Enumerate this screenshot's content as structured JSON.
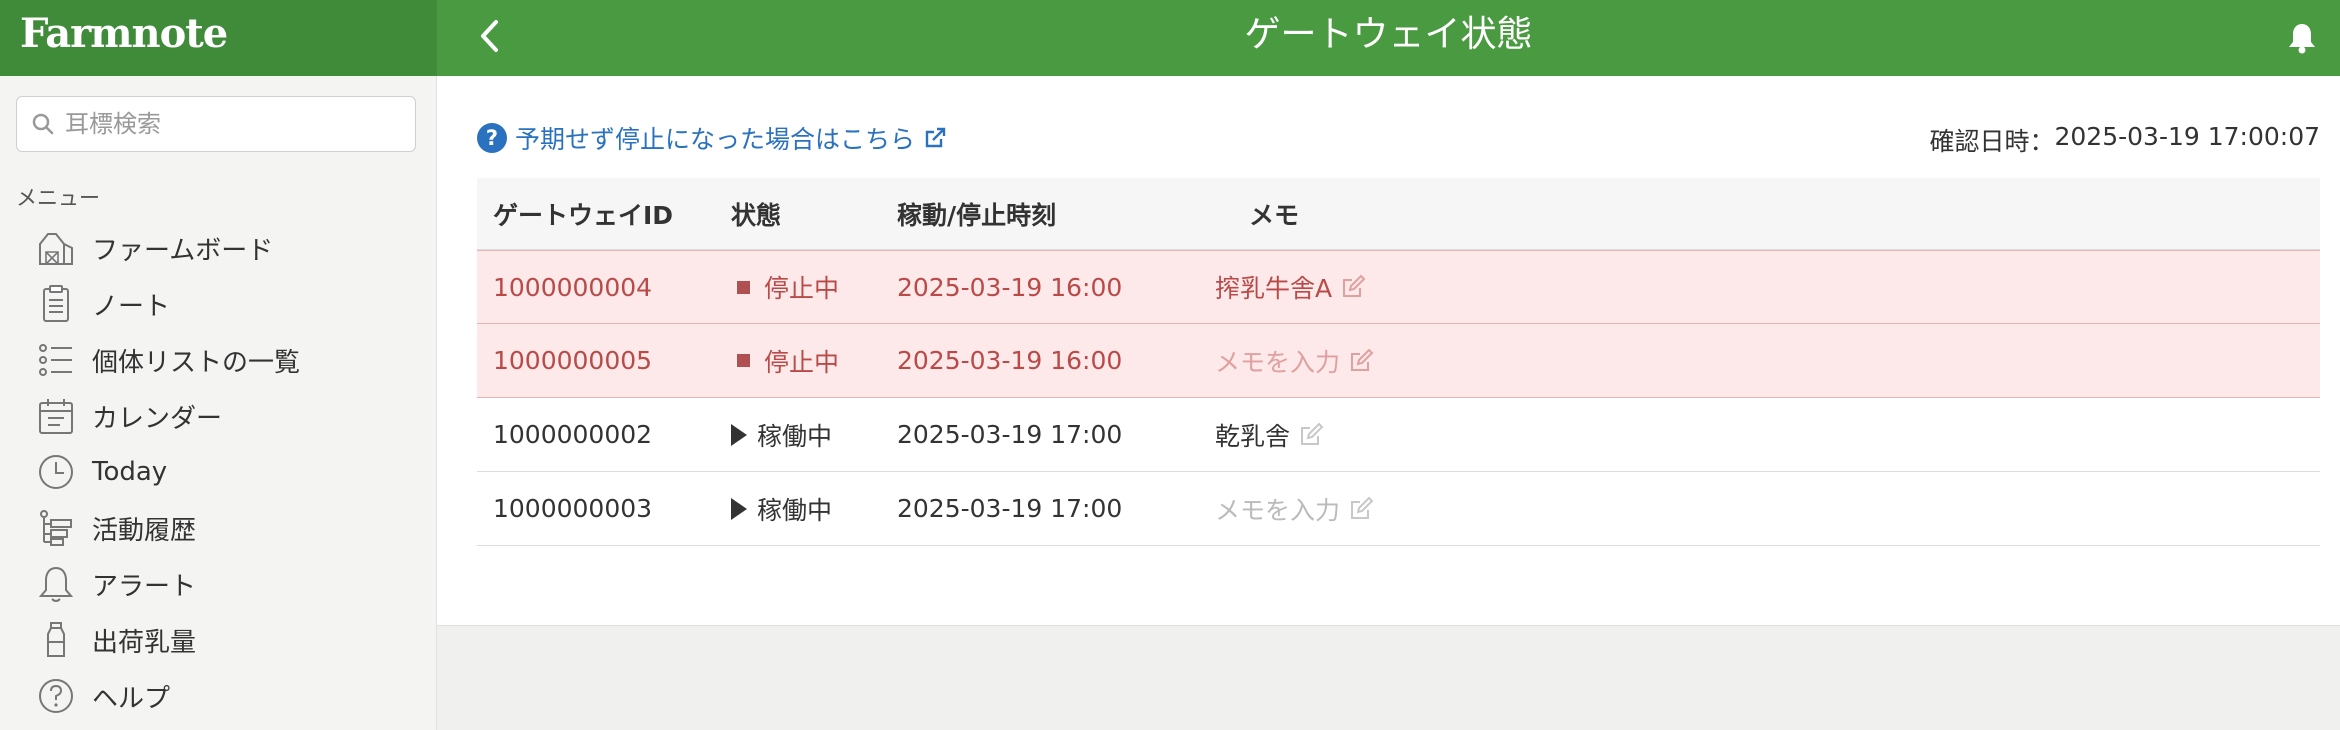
{
  "brand": {
    "logo_text": "Farmnote"
  },
  "header": {
    "title": "ゲートウェイ状態"
  },
  "sidebar": {
    "search_placeholder": "耳標検索",
    "menu_heading": "メニュー",
    "items": [
      {
        "label": "ファームボード",
        "icon": "barn-icon"
      },
      {
        "label": "ノート",
        "icon": "note-icon"
      },
      {
        "label": "個体リストの一覧",
        "icon": "list-icon"
      },
      {
        "label": "カレンダー",
        "icon": "calendar-icon"
      },
      {
        "label": "Today",
        "icon": "clock-icon"
      },
      {
        "label": "活動履歴",
        "icon": "history-icon"
      },
      {
        "label": "アラート",
        "icon": "bell-icon"
      },
      {
        "label": "出荷乳量",
        "icon": "milk-bottle-icon"
      },
      {
        "label": "ヘルプ",
        "icon": "help-icon"
      }
    ]
  },
  "main": {
    "help_link": "予期せず停止になった場合はこちら",
    "confirm_label": "確認日時：",
    "confirm_datetime": "2025-03-19 17:00:07",
    "columns": [
      "ゲートウェイID",
      "状態",
      "稼動/停止時刻",
      "メモ"
    ],
    "rows": [
      {
        "id": "1000000004",
        "status": "停止中",
        "time": "2025-03-19 16:00",
        "memo": "搾乳牛舎A"
      },
      {
        "id": "1000000005",
        "status": "停止中",
        "time": "2025-03-19 16:00",
        "memo": "メモを入力"
      },
      {
        "id": "1000000002",
        "status": "稼働中",
        "time": "2025-03-19 17:00",
        "memo": "乾乳舎"
      },
      {
        "id": "1000000003",
        "status": "稼働中",
        "time": "2025-03-19 17:00",
        "memo": "メモを入力"
      }
    ]
  },
  "colors": {
    "brand_green": "#3f8b3a",
    "header_green": "#4a9a41",
    "stopped_bg": "#fde9ea",
    "stopped_text": "#b94a48",
    "link_blue": "#2a72c0"
  }
}
